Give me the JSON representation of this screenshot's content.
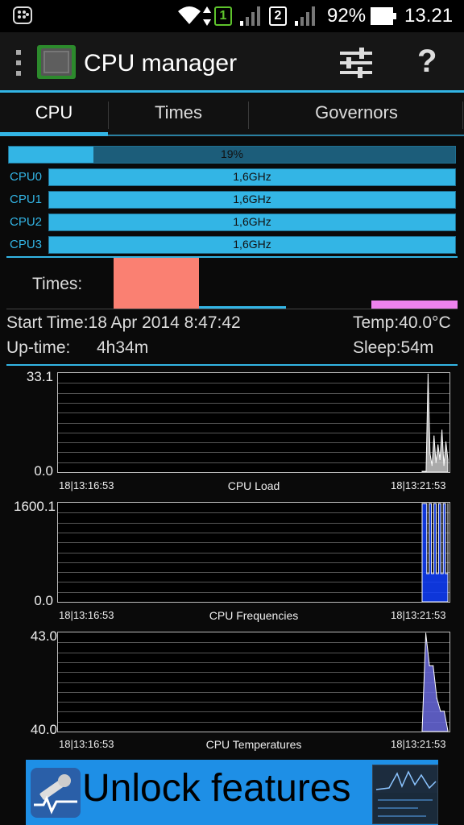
{
  "status_bar": {
    "sim1": "1",
    "sim2": "2",
    "battery": "92%",
    "time": "13.21"
  },
  "app": {
    "title": "CPU manager",
    "actions": [
      "settings-sliders",
      "help"
    ]
  },
  "tabs": [
    {
      "label": "CPU",
      "active": true
    },
    {
      "label": "Times",
      "active": false
    },
    {
      "label": "Governors",
      "active": false
    }
  ],
  "cpu": {
    "total_load_label": "19%",
    "total_load": 0.19,
    "cores": [
      {
        "name": "CPU0",
        "freq": "1,6GHz",
        "fill": 1.0
      },
      {
        "name": "CPU1",
        "freq": "1,6GHz",
        "fill": 1.0
      },
      {
        "name": "CPU2",
        "freq": "1,6GHz",
        "fill": 1.0
      },
      {
        "name": "CPU3",
        "freq": "1,6GHz",
        "fill": 1.0
      }
    ]
  },
  "times": {
    "label": "Times:",
    "segments": [
      {
        "color": "#fa8072",
        "value": 0.22
      },
      {
        "color": "#33b5e5",
        "value": 0.22
      },
      {
        "color": "#ee82ee",
        "value": 0.22
      }
    ]
  },
  "info": {
    "start_time": "Start Time:18 Apr 2014 8:47:42",
    "temp": "Temp:40.0°C",
    "uptime_label": "Up-time:",
    "uptime_value": "4h34m",
    "sleep": "Sleep:54m"
  },
  "chart_data": [
    {
      "type": "area",
      "title": "CPU Load",
      "ylim": [
        0.0,
        33.1
      ],
      "y_labels": [
        "33.1",
        "0.0"
      ],
      "x_labels": [
        "18|13:16:53",
        "18|13:21:53"
      ],
      "color": "#c8c8c8",
      "values": [
        0,
        0,
        0,
        33,
        6,
        2,
        12,
        3,
        9,
        4,
        14,
        2,
        10,
        4
      ]
    },
    {
      "type": "area",
      "title": "CPU Frequencies",
      "ylim": [
        0.0,
        1600.1
      ],
      "y_labels": [
        "1600.1",
        "0.0"
      ],
      "x_labels": [
        "18|13:16:53",
        "18|13:21:53"
      ],
      "color": "#1040ff",
      "values": [
        1600,
        1600,
        450,
        1600,
        450,
        1600,
        450,
        1600,
        450,
        1600,
        450,
        1600
      ]
    },
    {
      "type": "area",
      "title": "CPU Temperatures",
      "ylim": [
        40.0,
        43.0
      ],
      "y_labels": [
        "43.0",
        "40.0"
      ],
      "x_labels": [
        "18|13:16:53",
        "18|13:21:53"
      ],
      "color": "#6a6add",
      "values": [
        40.0,
        43.0,
        42.0,
        42.0,
        41.0,
        40.6,
        40.6,
        40.0
      ]
    }
  ],
  "ad": {
    "text": "Unlock features"
  }
}
